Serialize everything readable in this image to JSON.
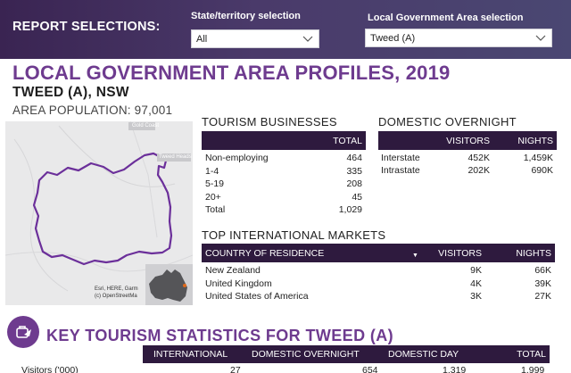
{
  "header": {
    "report_selections": "REPORT SELECTIONS:",
    "state_label": "State/territory selection",
    "state_value": "All",
    "lga_label": "Local Government Area selection",
    "lga_value": "Tweed (A)"
  },
  "titles": {
    "main": "LOCAL GOVERNMENT AREA PROFILES, 2019",
    "area": "TWEED (A), NSW",
    "population": "AREA POPULATION: 97,001"
  },
  "map": {
    "label_top": "Gold Coast",
    "label_right": "Tweed Heads",
    "attribution_1": "Esri, HERE, Garm",
    "attribution_2": "(c) OpenStreetMa"
  },
  "tourism_businesses": {
    "heading": "TOURISM BUSINESSES",
    "column": "TOTAL",
    "rows": [
      {
        "label": "Non-employing",
        "value": "464"
      },
      {
        "label": "1-4",
        "value": "335"
      },
      {
        "label": "5-19",
        "value": "208"
      },
      {
        "label": "20+",
        "value": "45"
      },
      {
        "label": "Total",
        "value": "1,029"
      }
    ]
  },
  "domestic_overnight": {
    "heading": "DOMESTIC OVERNIGHT",
    "col_visitors": "VISITORS",
    "col_nights": "NIGHTS",
    "rows": [
      {
        "label": "Interstate",
        "visitors": "452K",
        "nights": "1,459K"
      },
      {
        "label": "Intrastate",
        "visitors": "202K",
        "nights": "690K"
      }
    ]
  },
  "international_markets": {
    "heading": "TOP INTERNATIONAL MARKETS",
    "col_country": "COUNTRY OF RESIDENCE",
    "col_visitors": "VISITORS",
    "col_nights": "NIGHTS",
    "sort_icon": "sort-down-icon",
    "rows": [
      {
        "country": "New Zealand",
        "visitors": "9K",
        "nights": "66K"
      },
      {
        "country": "United Kingdom",
        "visitors": "4K",
        "nights": "39K"
      },
      {
        "country": "United States of America",
        "visitors": "3K",
        "nights": "27K"
      }
    ]
  },
  "key_statistics": {
    "title": "KEY TOURISM STATISTICS FOR TWEED (A)",
    "icon": "tourism-icon",
    "col_international": "INTERNATIONAL",
    "col_domestic_overnight": "DOMESTIC OVERNIGHT",
    "col_domestic_day": "DOMESTIC DAY",
    "col_total": "TOTAL",
    "row_label": "Visitors ('000)",
    "row_international": "27",
    "row_domestic_overnight": "654",
    "row_domestic_day": "1,319",
    "row_total": "1,999"
  },
  "colors": {
    "header_bg": "#3a2452",
    "accent": "#6e3b8f",
    "table_header": "#2e1a3e",
    "lga_outline": "#6b2f9a"
  }
}
